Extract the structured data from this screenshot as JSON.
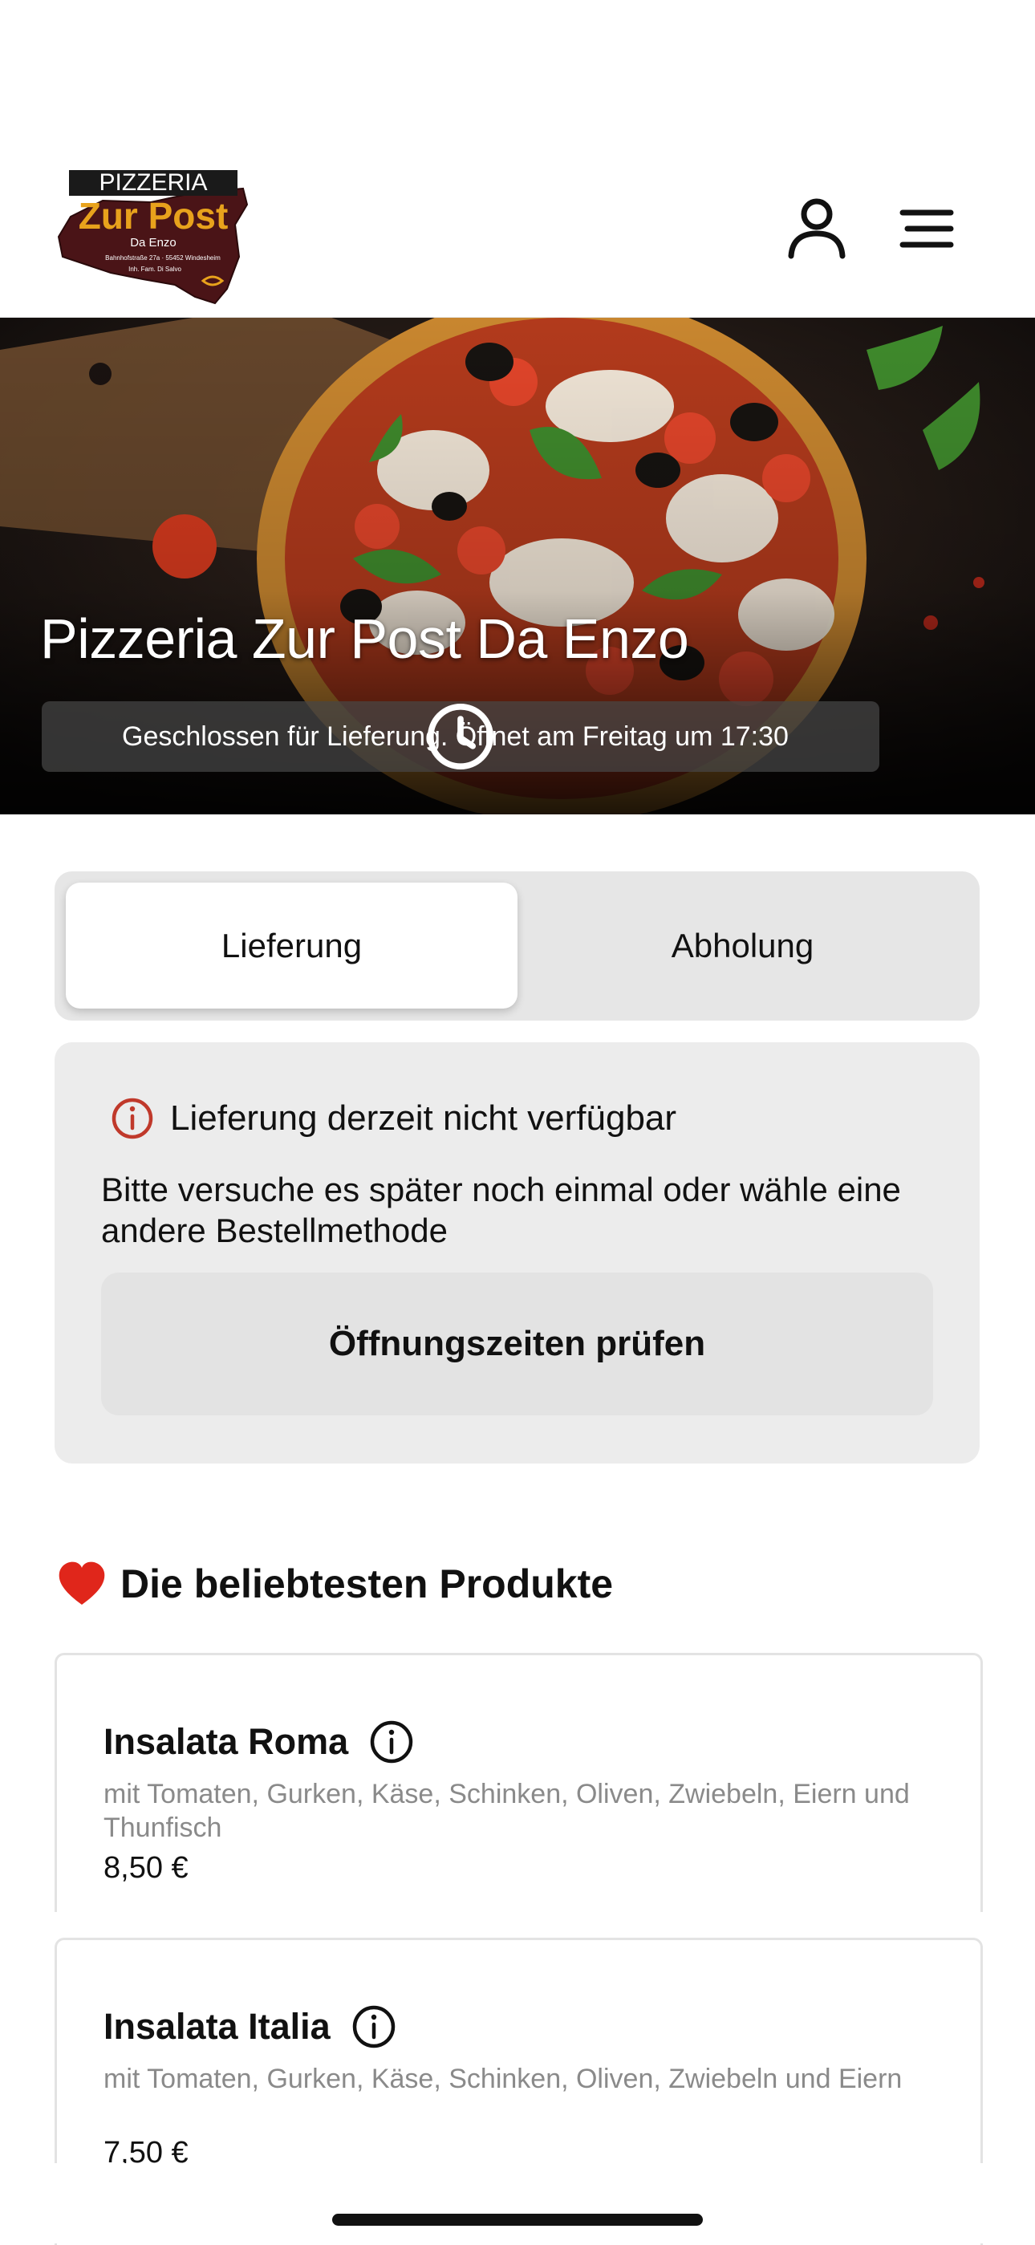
{
  "header": {
    "logo": {
      "line1": "PIZZERIA",
      "line2": "Zur Post",
      "line3": "Da Enzo",
      "line4": "Bahnhofstraße 27a · 55452 Windesheim",
      "line5": "Inh. Fam. Di Salvo"
    },
    "icons": [
      "user-icon",
      "menu-icon"
    ]
  },
  "hero": {
    "title": "Pizzeria Zur Post Da Enzo",
    "status": "Geschlossen für Lieferung. Öffnet am Freitag um 17:30"
  },
  "order_mode": {
    "options": [
      {
        "label": "Lieferung",
        "selected": true
      },
      {
        "label": "Abholung",
        "selected": false
      }
    ]
  },
  "notice": {
    "title": "Lieferung derzeit nicht verfügbar",
    "body": "Bitte versuche es später noch einmal oder wähle eine andere Bestellmethode",
    "button": "Öffnungszeiten prüfen"
  },
  "popular": {
    "heading": "Die beliebtesten Produkte",
    "products": [
      {
        "name": "Insalata Roma",
        "description": "mit Tomaten, Gurken, Käse, Schinken, Oliven, Zwiebeln, Eiern und Thunfisch",
        "price": "8,50 €"
      },
      {
        "name": "Insalata Italia",
        "description": "mit Tomaten, Gurken, Käse, Schinken, Oliven, Zwiebeln und Eiern",
        "price": "7,50 €"
      }
    ]
  },
  "colors": {
    "accent_red": "#c0392b",
    "segment_bg": "#e6e6e6",
    "notice_bg": "#ececec"
  }
}
